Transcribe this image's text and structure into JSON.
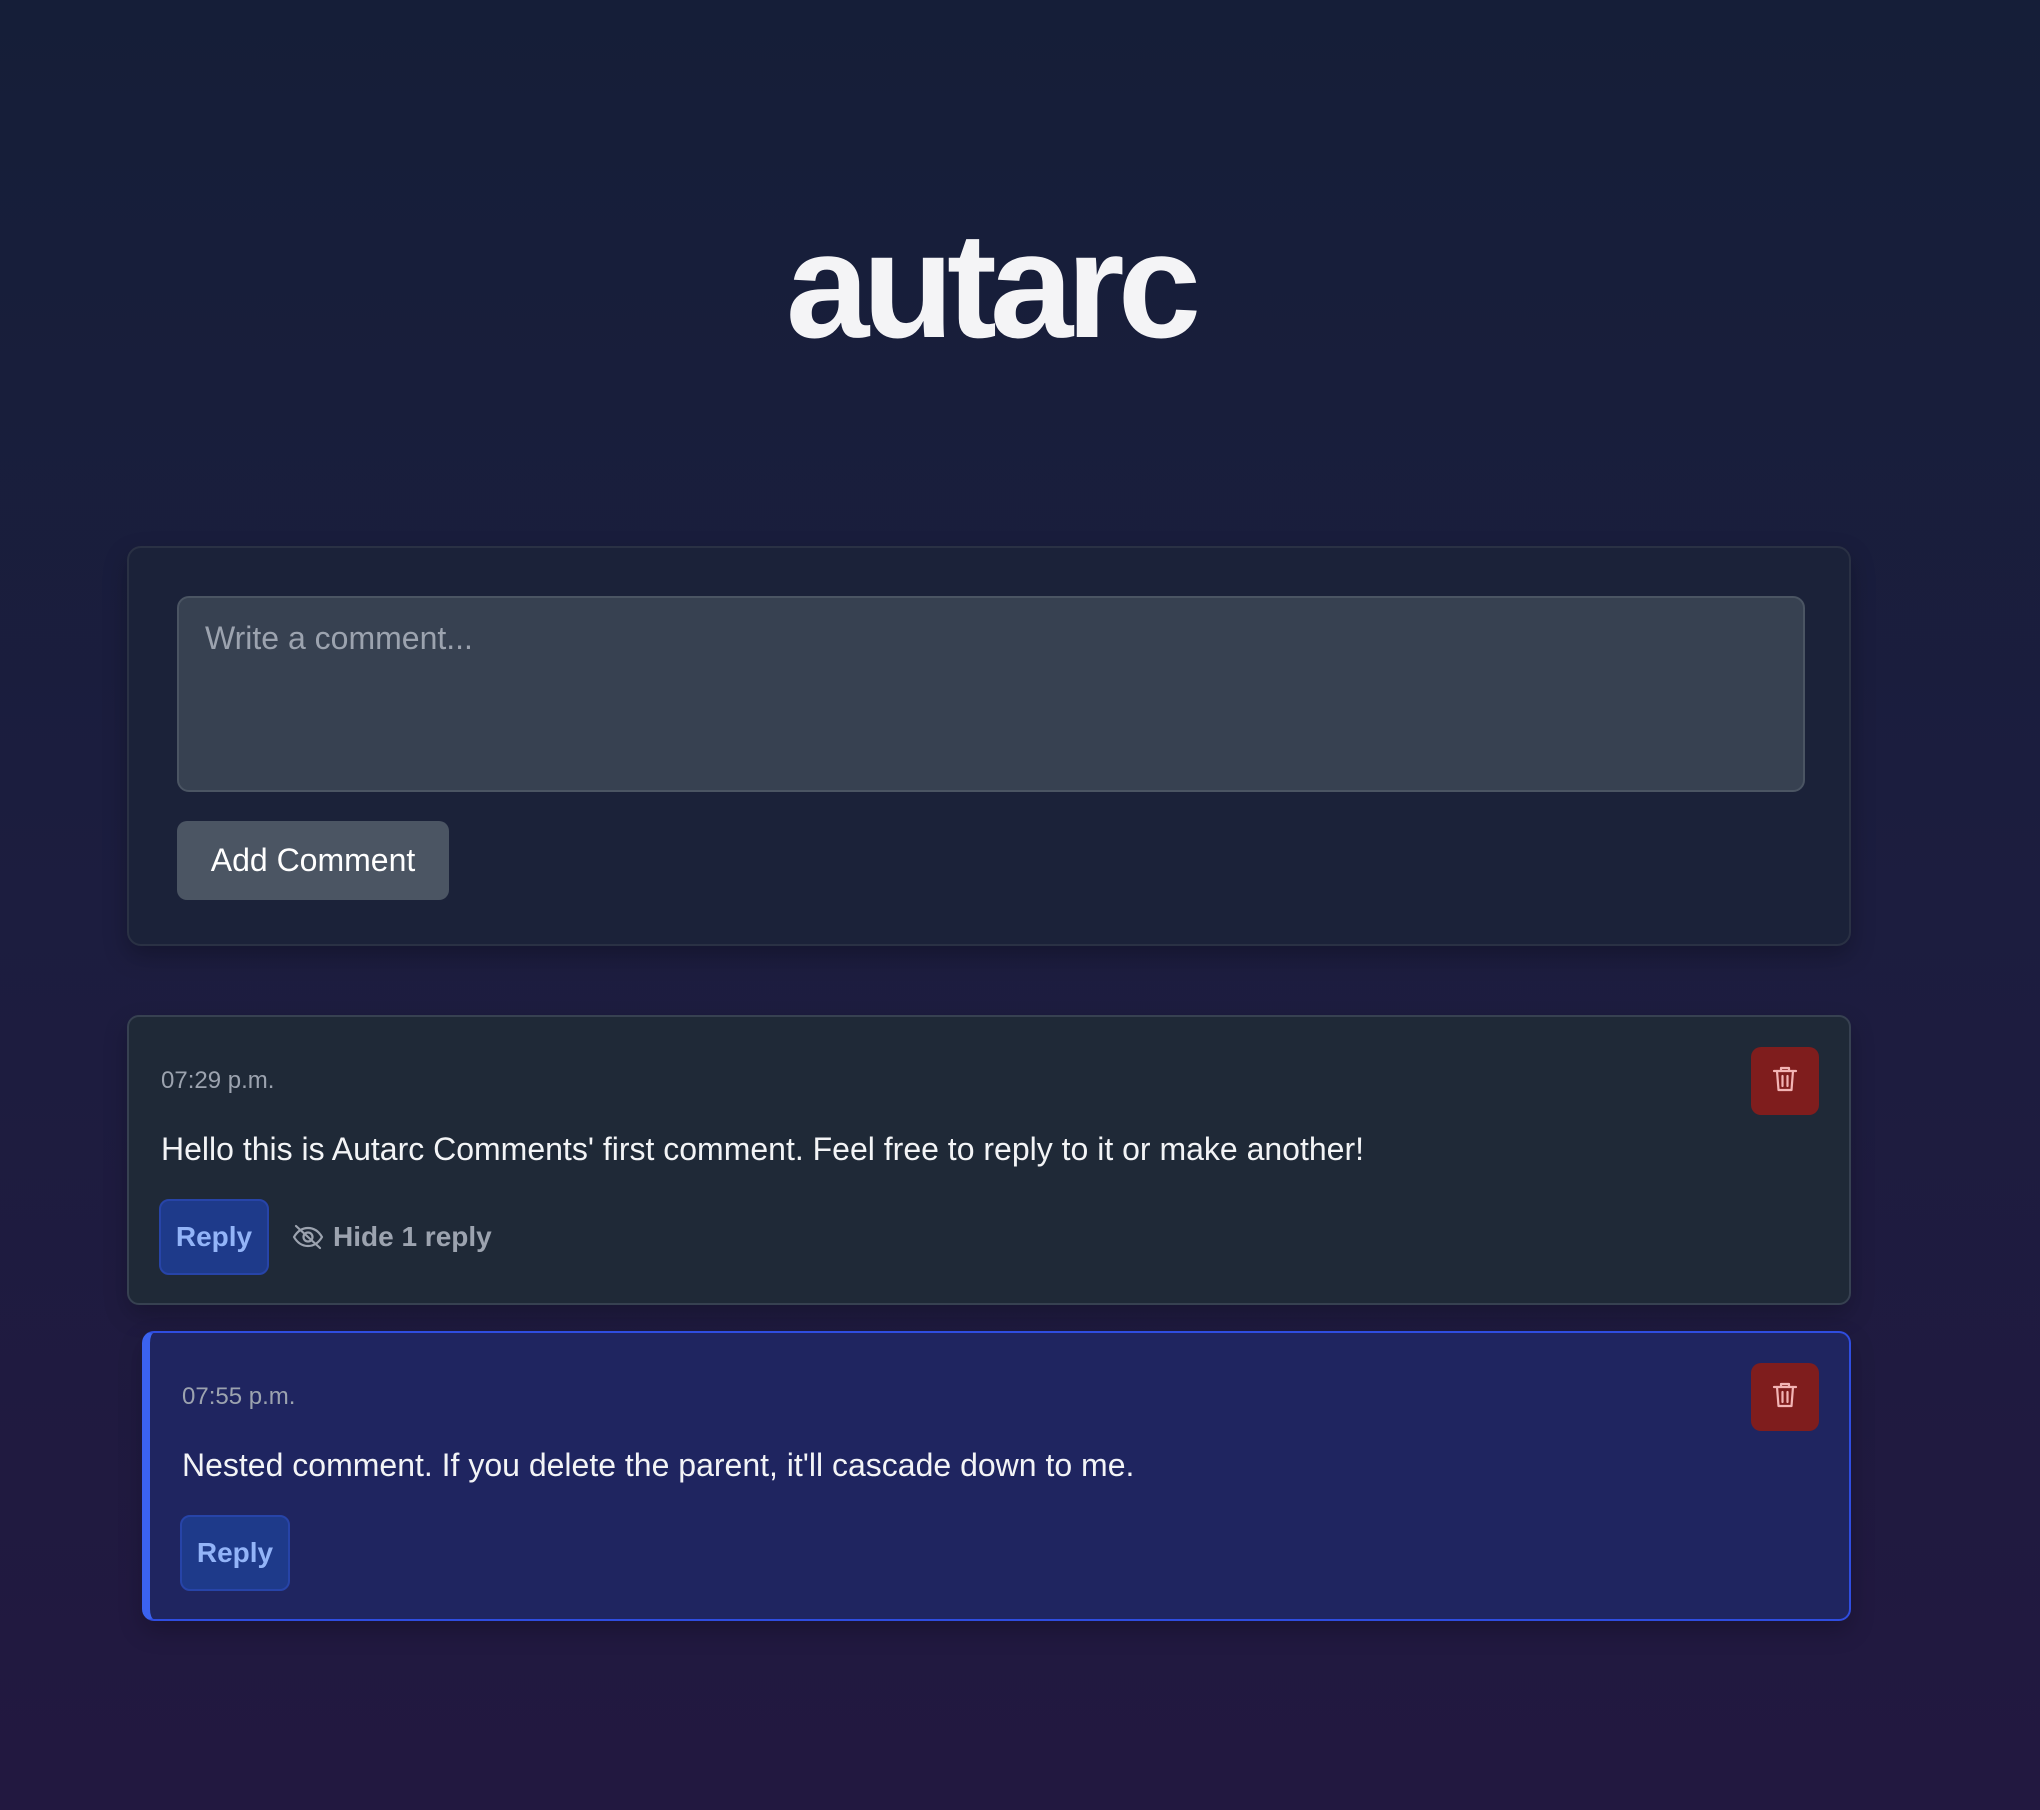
{
  "header": {
    "logo_text": "autarc"
  },
  "composer": {
    "placeholder": "Write a comment...",
    "value": "",
    "add_button_label": "Add Comment"
  },
  "comments": [
    {
      "timestamp": "07:29 p.m.",
      "text": "Hello this is Autarc Comments' first comment. Feel free to reply to it or make another!",
      "reply_label": "Reply",
      "toggle_replies_label": "Hide 1 reply",
      "toggle_icon": "eye-off-icon",
      "delete_icon": "trash-icon"
    },
    {
      "timestamp": "07:55 p.m.",
      "text": "Nested comment. If you delete the parent, it'll cascade down to me.",
      "reply_label": "Reply",
      "delete_icon": "trash-icon",
      "nested": true
    }
  ],
  "colors": {
    "background_top": "#151e38",
    "background_bottom": "#221840",
    "delete_button": "#7f1d1d",
    "reply_button": "#1e3a8a",
    "nested_accent": "#3b62f0"
  }
}
